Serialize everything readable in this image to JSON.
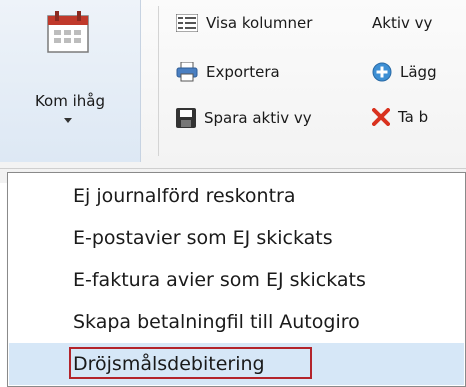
{
  "ribbon": {
    "big_button": {
      "label": "Kom ihåg",
      "icon": "calendar-icon"
    },
    "items": [
      {
        "label": "Visa kolumner",
        "icon": "columns-icon"
      },
      {
        "label": "Exportera",
        "icon": "printer-icon"
      },
      {
        "label": "Spara aktiv vy",
        "icon": "save-icon"
      },
      {
        "label": "Aktiv vy",
        "icon": ""
      },
      {
        "label": "Lägg",
        "icon": "add-icon"
      },
      {
        "label": "Ta b",
        "icon": "delete-icon"
      }
    ]
  },
  "menu": {
    "items": [
      {
        "label": "Ej journalförd reskontra",
        "highlighted": false
      },
      {
        "label": "E-postavier som EJ skickats",
        "highlighted": false
      },
      {
        "label": "E-faktura avier som EJ skickats",
        "highlighted": false
      },
      {
        "label": "Skapa betalningfil till Autogiro",
        "highlighted": false
      },
      {
        "label": "Dröjsmålsdebitering",
        "highlighted": true
      }
    ]
  },
  "colors": {
    "highlight_bg": "#d6e7f7",
    "highlight_border": "#b3242b",
    "calendar_red": "#c0392b"
  }
}
